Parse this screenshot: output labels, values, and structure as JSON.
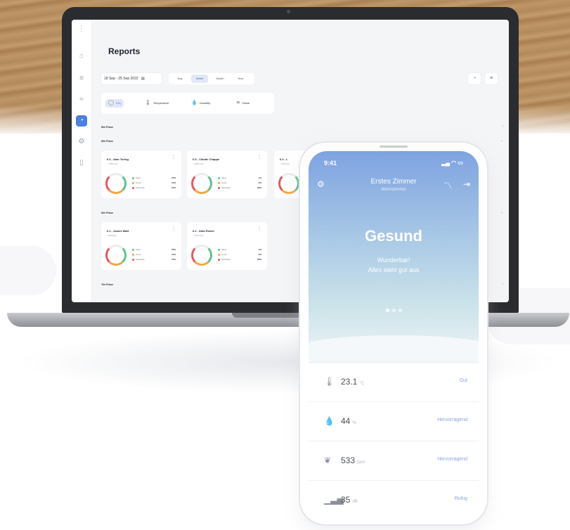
{
  "laptop": {
    "page_title": "Reports",
    "date_range": "18 Sep - 25 Sep 2022",
    "date_icon": "calendar-icon",
    "periods": [
      "Day",
      "Week",
      "Month",
      "Year"
    ],
    "active_period": "Week",
    "metrics": [
      {
        "icon": "thermometer-icon",
        "label": "Temperature"
      },
      {
        "icon": "droplet-icon",
        "label": "Humidity"
      },
      {
        "icon": "wave-icon",
        "label": "Noise"
      }
    ],
    "active_metric_label": "CO₂",
    "floors": {
      "f1": "6th Floor",
      "f2": "6th Floor",
      "f3": "6th Floor",
      "f4": "7th Floor"
    },
    "legend": [
      "Ideal",
      "Good",
      "Moderate"
    ],
    "cards": [
      {
        "title": "6.6 - Alan Turing",
        "sub": "~ 1000 ppm",
        "pcts": [
          "78%",
          "12%",
          "10%"
        ]
      },
      {
        "title": "6.5 - Claude Chappe",
        "sub": "~ 1000 ppm",
        "pcts": [
          "1%",
          "9%",
          "90%"
        ]
      },
      {
        "title": "6.4 - L",
        "sub": "~ 800 ppm"
      },
      {
        "title": "6.1 - James Watt",
        "sub": "~ 800 ppm",
        "pcts": [
          "78%",
          "12%",
          "10%"
        ]
      },
      {
        "title": "6.2 - Alba Parker",
        "sub": "~ 1000 ppm",
        "pcts": [
          "1%",
          "9%",
          "90%"
        ]
      }
    ],
    "colors": {
      "accent": "#4d7fe0",
      "ideal": "#5cc38b",
      "good": "#f0a846",
      "bad": "#e4595c"
    }
  },
  "phone": {
    "time": "9:41",
    "room": "Erstes Zimmer",
    "room_sub": "Wohnzimmer",
    "status": "Gesund",
    "message_line1": "Wunderbar!",
    "message_line2": "Alles sieht gut aus",
    "page_dots": 3,
    "readings": [
      {
        "icon": "thermometer-icon",
        "value": "23.1",
        "unit": "°C",
        "label": "Gut"
      },
      {
        "icon": "droplet-icon",
        "value": "44",
        "unit": "%",
        "label": "Hervorragend"
      },
      {
        "icon": "leaf-icon",
        "value": "533",
        "unit": "ppm",
        "label": "Hervorragend"
      },
      {
        "icon": "sound-icon",
        "value": "35",
        "unit": "dB",
        "label": "Ruhig"
      }
    ]
  }
}
